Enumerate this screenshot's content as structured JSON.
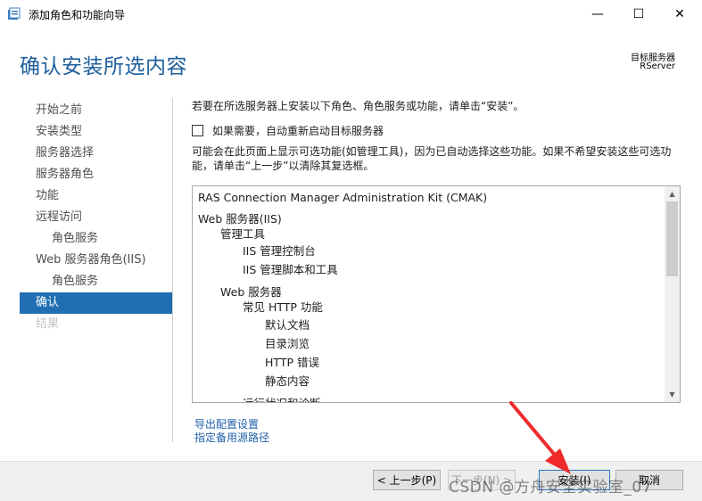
{
  "window": {
    "title": "添加角色和功能向导",
    "controls": {
      "minimize": "—",
      "maximize": "☐",
      "close": "✕"
    }
  },
  "header": {
    "page_title": "确认安装所选内容",
    "target_label": "目标服务器",
    "target_value": "RServer"
  },
  "nav": {
    "items": [
      {
        "label": "开始之前",
        "state": "normal",
        "level": 0
      },
      {
        "label": "安装类型",
        "state": "normal",
        "level": 0
      },
      {
        "label": "服务器选择",
        "state": "normal",
        "level": 0
      },
      {
        "label": "服务器角色",
        "state": "normal",
        "level": 0
      },
      {
        "label": "功能",
        "state": "normal",
        "level": 0
      },
      {
        "label": "远程访问",
        "state": "normal",
        "level": 0
      },
      {
        "label": "角色服务",
        "state": "normal",
        "level": 1
      },
      {
        "label": "Web 服务器角色(IIS)",
        "state": "normal",
        "level": 0
      },
      {
        "label": "角色服务",
        "state": "normal",
        "level": 1
      },
      {
        "label": "确认",
        "state": "active",
        "level": 0
      },
      {
        "label": "结果",
        "state": "disabled",
        "level": 0
      }
    ]
  },
  "main": {
    "intro": "若要在所选服务器上安装以下角色、角色服务或功能，请单击“安装”。",
    "restart_label": "如果需要，自动重新启动目标服务器",
    "note": "可能会在此页面上显示可选功能(如管理工具)，因为已自动选择这些功能。如果不希望安装这些可选功能，请单击“上一步”以清除其复选框。",
    "features": [
      {
        "label": "RAS Connection Manager Administration Kit (CMAK)",
        "level": 0
      },
      {
        "label": "Web 服务器(IIS)",
        "level": 0
      },
      {
        "label": "管理工具",
        "level": 1
      },
      {
        "label": "IIS 管理控制台",
        "level": 2
      },
      {
        "label": "IIS 管理脚本和工具",
        "level": 2
      },
      {
        "label": "Web 服务器",
        "level": 1
      },
      {
        "label": "常见 HTTP 功能",
        "level": 2
      },
      {
        "label": "默认文档",
        "level": 3
      },
      {
        "label": "目录浏览",
        "level": 3
      },
      {
        "label": "HTTP 错误",
        "level": 3
      },
      {
        "label": "静态内容",
        "level": 3
      },
      {
        "label": "运行状况和诊断",
        "level": 2
      }
    ],
    "links": {
      "export": "导出配置设置",
      "alt_source": "指定备用源路径"
    }
  },
  "footer": {
    "prev": "< 上一步(P)",
    "next": "下一步(N) >",
    "install": "安装(I)",
    "cancel": "取消"
  },
  "watermark": "CSDN @方舟安全实验室_07",
  "colors": {
    "accent": "#1f6fb2",
    "title": "#1c5e9a",
    "arrow": "#f02a2a"
  },
  "icons": {
    "app": "server-manager-icon",
    "checkbox": "checkbox-unchecked"
  }
}
